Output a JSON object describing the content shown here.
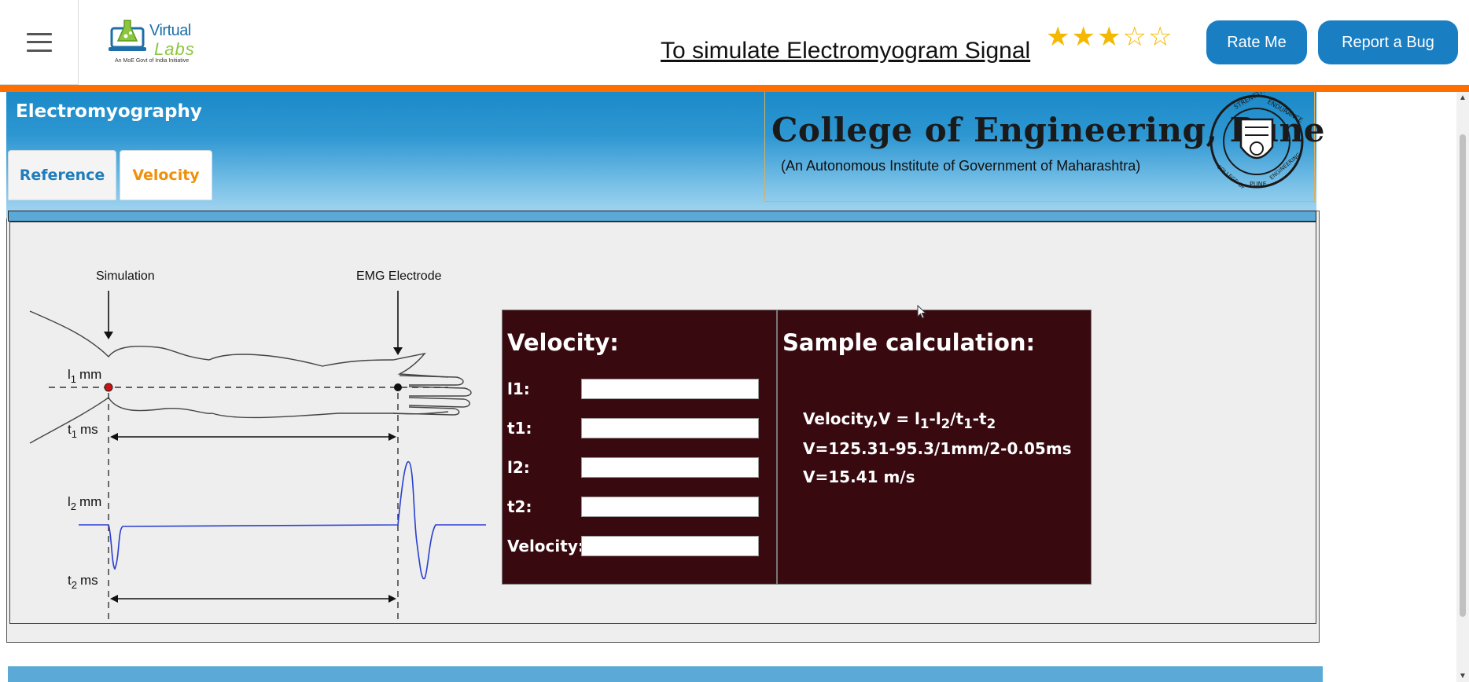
{
  "nav": {
    "title": "To simulate Electromyogram Signal",
    "rating": 3,
    "rating_max": 5,
    "star_full_glyph": "★",
    "star_empty_glyph": "☆",
    "rate_label": "Rate Me",
    "bug_label": "Report a Bug",
    "logo": {
      "word1": "Virtual",
      "word2": "Labs",
      "tagline": "An MoE Govt of India Initiative"
    },
    "accent_color": "#ff6f00",
    "button_color": "#1a7ec3"
  },
  "header": {
    "experiment_title": "Electromyography",
    "tabs": [
      {
        "label": "Reference",
        "active": false
      },
      {
        "label": "Velocity",
        "active": true
      }
    ],
    "college_name": "College of Engineering, Pune",
    "college_sub": "(An Autonomous Institute of Government of Maharashtra)",
    "seal_text": [
      "STRENGTH",
      "ENDURANCE",
      "COLLEGE OF",
      "ENGINEERING",
      "PUNE"
    ]
  },
  "diagram": {
    "label_simulation": "Simulation",
    "label_electrode": "EMG Electrode",
    "l1": "l",
    "l1_sub": "1",
    "l1_unit": "mm",
    "t1": "t",
    "t1_sub": "1",
    "t1_unit": "ms",
    "l2": "l",
    "l2_sub": "2",
    "l2_unit": "mm",
    "t2": "t",
    "t2_sub": "2",
    "t2_unit": "ms"
  },
  "velocity_form": {
    "heading": "Velocity:",
    "fields": [
      {
        "label": "l1:",
        "value": ""
      },
      {
        "label": "t1:",
        "value": ""
      },
      {
        "label": "l2:",
        "value": ""
      },
      {
        "label": "t2:",
        "value": ""
      },
      {
        "label": "Velocity:",
        "value": ""
      }
    ]
  },
  "sample": {
    "heading": "Sample calculation:",
    "formula_prefix": "Velocity,V = l",
    "formula_s1": "1",
    "formula_mid1": "-l",
    "formula_s2": "2",
    "formula_mid2": "/t",
    "formula_s3": "1",
    "formula_mid3": "-t",
    "formula_s4": "2",
    "line2": "V=125.31-95.3/1mm/2-0.05ms",
    "line3": "V=15.41 m/s"
  }
}
